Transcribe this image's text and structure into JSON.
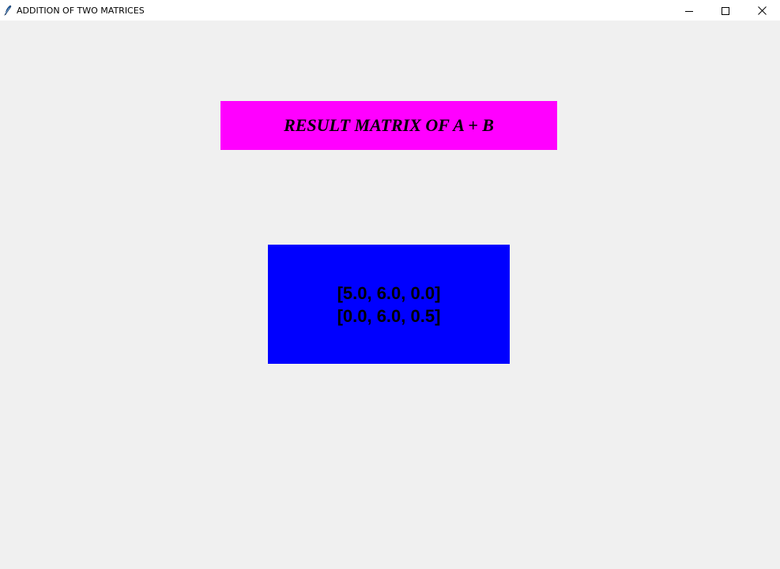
{
  "window": {
    "title": "ADDITION OF TWO MATRICES",
    "icon": "feather-icon",
    "controls": [
      "minimize-icon",
      "maximize-icon",
      "close-icon"
    ]
  },
  "heading": {
    "text": "RESULT MATRIX OF A + B",
    "background": "#ff00ff"
  },
  "result": {
    "background": "#0000ff",
    "rows": [
      "[5.0, 6.0, 0.0]",
      "[0.0, 6.0, 0.5]"
    ]
  }
}
